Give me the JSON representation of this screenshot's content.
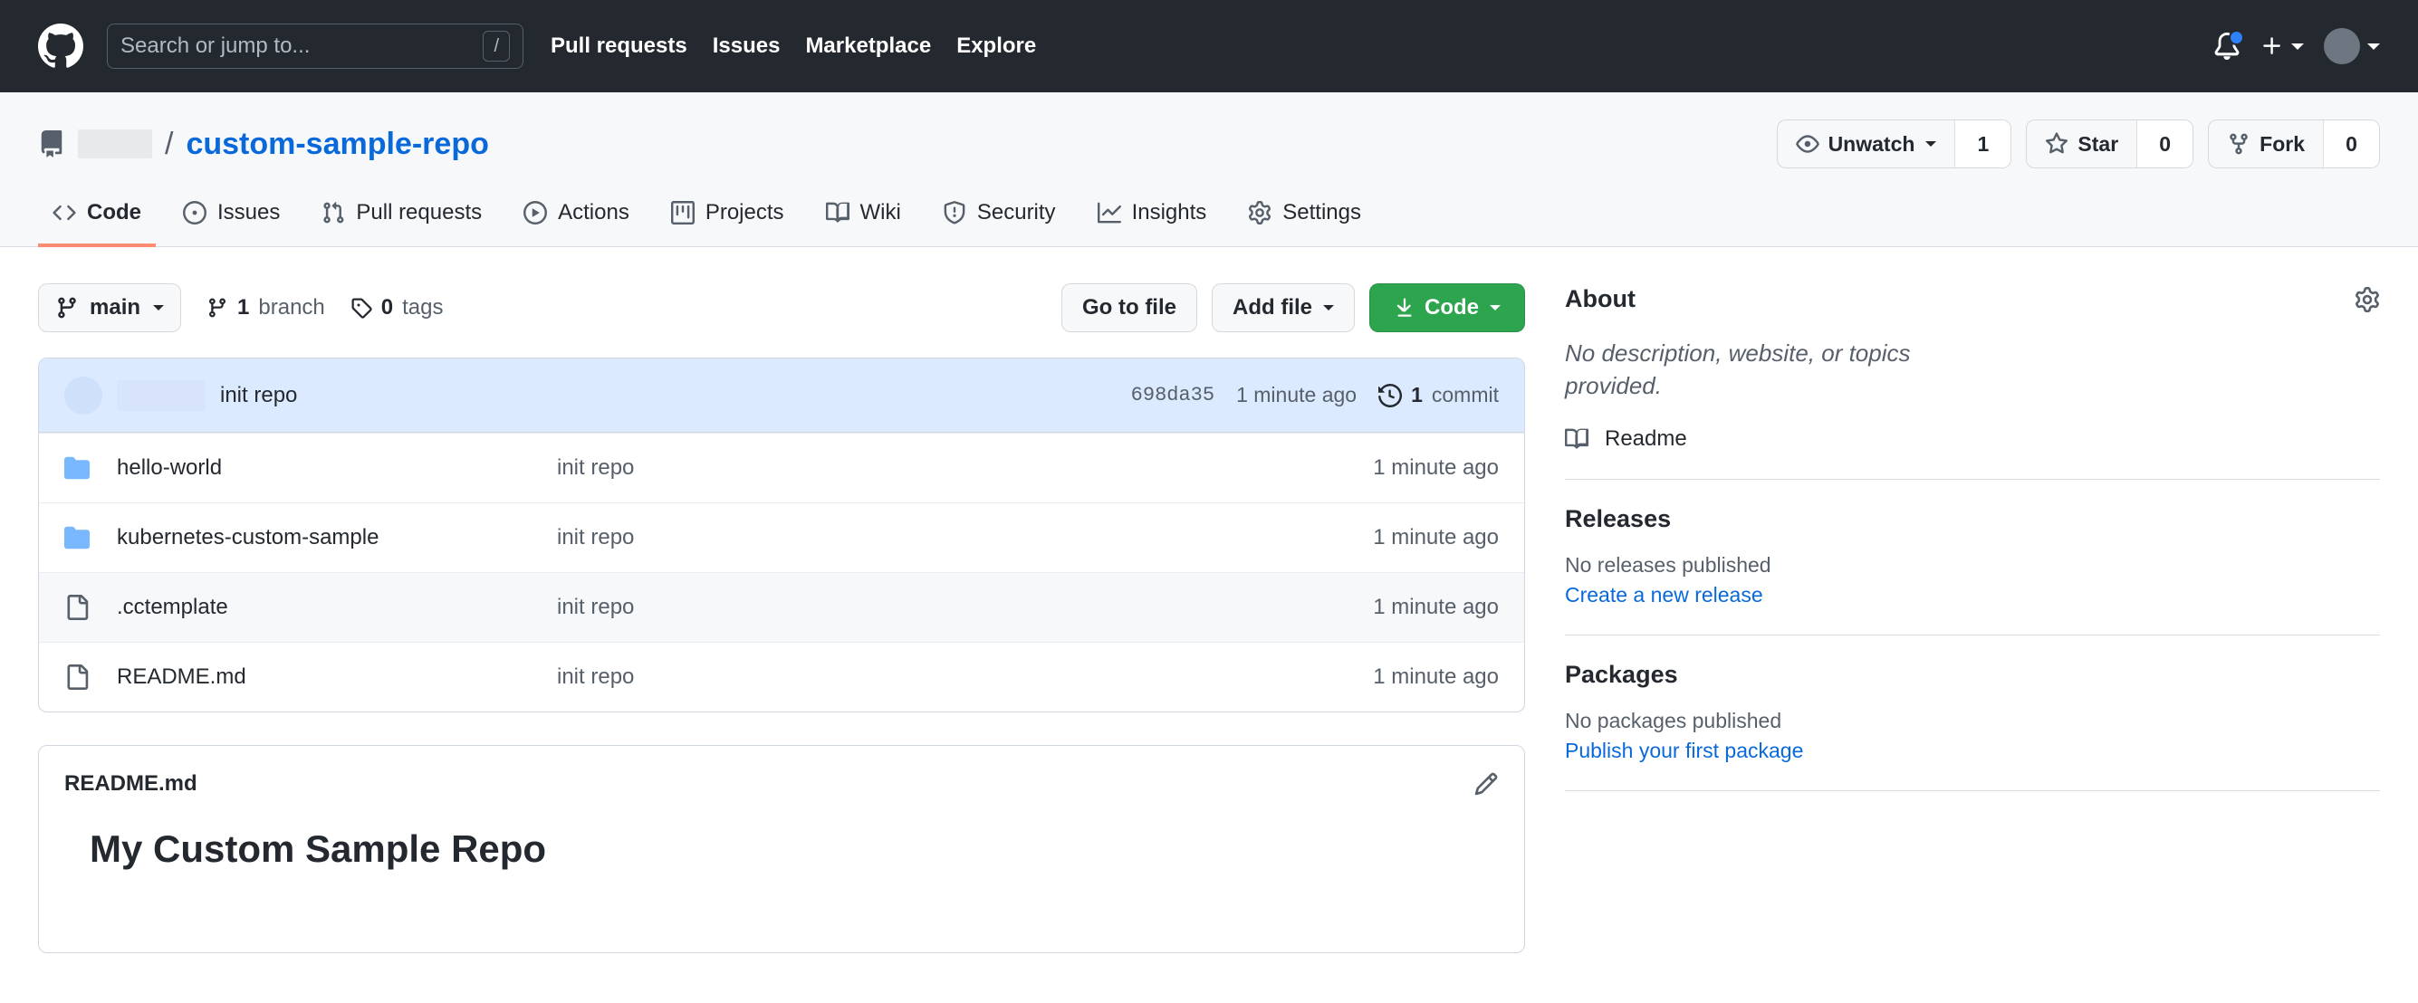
{
  "header": {
    "logo_icon": "github-mark-icon",
    "search": {
      "placeholder": "Search or jump to...",
      "value": "",
      "shortcut_key": "/"
    },
    "nav": [
      {
        "label": "Pull requests"
      },
      {
        "label": "Issues"
      },
      {
        "label": "Marketplace"
      },
      {
        "label": "Explore"
      }
    ],
    "notifications_icon": "bell-icon",
    "has_unread_notifications": true,
    "create_new_icon": "plus-icon",
    "avatar_icon": "user-avatar"
  },
  "repo": {
    "type_icon": "repo-book-icon",
    "owner": "",
    "owner_redacted": true,
    "separator": "/",
    "name": "custom-sample-repo",
    "actions": {
      "watch_label": "Unwatch",
      "watch_count": "1",
      "watch_icon": "eye-icon",
      "star_label": "Star",
      "star_count": "0",
      "star_icon": "star-icon",
      "fork_label": "Fork",
      "fork_count": "0",
      "fork_icon": "repo-forked-icon"
    },
    "tabs": [
      {
        "label": "Code",
        "icon": "code-icon",
        "active": true
      },
      {
        "label": "Issues",
        "icon": "issue-opened-icon",
        "active": false
      },
      {
        "label": "Pull requests",
        "icon": "git-pull-request-icon",
        "active": false
      },
      {
        "label": "Actions",
        "icon": "play-icon",
        "active": false
      },
      {
        "label": "Projects",
        "icon": "project-icon",
        "active": false
      },
      {
        "label": "Wiki",
        "icon": "book-icon",
        "active": false
      },
      {
        "label": "Security",
        "icon": "shield-icon",
        "active": false
      },
      {
        "label": "Insights",
        "icon": "graph-icon",
        "active": false
      },
      {
        "label": "Settings",
        "icon": "gear-icon",
        "active": false
      }
    ]
  },
  "toolbar": {
    "branch_name": "main",
    "branch_icon": "git-branch-icon",
    "branch_count_value": "1",
    "branch_count_label": "branch",
    "tag_count_value": "0",
    "tag_count_label": "tags",
    "tag_icon": "tag-icon",
    "go_to_file_label": "Go to file",
    "add_file_label": "Add file",
    "code_label": "Code",
    "code_icon": "download-icon"
  },
  "commit_bar": {
    "author": "",
    "author_redacted": true,
    "message": "init repo",
    "sha": "698da35",
    "time": "1 minute ago",
    "history_icon": "history-icon",
    "commit_count_value": "1",
    "commit_count_label": "commit"
  },
  "files": [
    {
      "name": "hello-world",
      "type": "dir",
      "icon": "folder-icon",
      "message": "init repo",
      "time": "1 minute ago",
      "highlighted": false
    },
    {
      "name": "kubernetes-custom-sample",
      "type": "dir",
      "icon": "folder-icon",
      "message": "init repo",
      "time": "1 minute ago",
      "highlighted": false
    },
    {
      "name": ".cctemplate",
      "type": "file",
      "icon": "file-icon",
      "message": "init repo",
      "time": "1 minute ago",
      "highlighted": true
    },
    {
      "name": "README.md",
      "type": "file",
      "icon": "file-icon",
      "message": "init repo",
      "time": "1 minute ago",
      "highlighted": false
    }
  ],
  "readme": {
    "title": "README.md",
    "edit_icon": "pencil-icon",
    "heading": "My Custom Sample Repo"
  },
  "sidebar": {
    "about": {
      "title": "About",
      "gear_icon": "gear-icon",
      "description": "No description, website, or topics provided.",
      "readme_label": "Readme",
      "readme_icon": "book-icon"
    },
    "releases": {
      "title": "Releases",
      "empty_text": "No releases published",
      "action_label": "Create a new release"
    },
    "packages": {
      "title": "Packages",
      "empty_text": "No packages published",
      "action_label": "Publish your first package"
    }
  },
  "colors": {
    "header_bg": "#24292f",
    "accent_link": "#0969da",
    "green_button": "#2da44e",
    "active_tab_underline": "#fd8c73",
    "folder_blue": "#79b8ff",
    "notification_dot": "#2f81f7"
  }
}
